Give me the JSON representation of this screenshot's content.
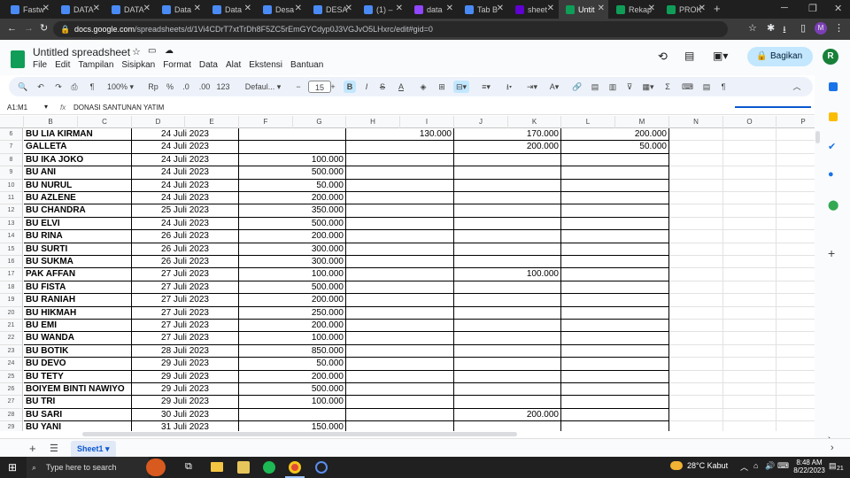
{
  "browser": {
    "tabs": [
      {
        "label": "Fastw",
        "icon": "docs-icon"
      },
      {
        "label": "DATA",
        "icon": "docs-icon"
      },
      {
        "label": "DATA",
        "icon": "docs-icon"
      },
      {
        "label": "Data",
        "icon": "docs-icon"
      },
      {
        "label": "Data",
        "icon": "docs-icon"
      },
      {
        "label": "Desa",
        "icon": "docs-icon"
      },
      {
        "label": "DESA",
        "icon": "docs-icon"
      },
      {
        "label": "(1) –",
        "icon": "docs-icon"
      },
      {
        "label": "data",
        "icon": "twitch-icon"
      },
      {
        "label": "Tab B",
        "icon": "globe-icon"
      },
      {
        "label": "sheet",
        "icon": "yahoo-icon"
      },
      {
        "label": "Untit",
        "icon": "sheets-icon",
        "active": true
      },
      {
        "label": "Rekap",
        "icon": "sheets-icon"
      },
      {
        "label": "PROK",
        "icon": "sheets-icon"
      }
    ],
    "new_tab": "+",
    "url_host": "docs.google.com",
    "url_path": "/spreadsheets/d/1Vi4CDrT7xtTrDh8F5ZC5rEmGYCdyp0J3VGJvO5LHxrc/edit#gid=0"
  },
  "app": {
    "title": "Untitled spreadsheet",
    "menus": [
      "File",
      "Edit",
      "Tampilan",
      "Sisipkan",
      "Format",
      "Data",
      "Alat",
      "Ekstensi",
      "Bantuan"
    ],
    "share_label": "Bagikan",
    "avatar_letter": "R"
  },
  "toolbar": {
    "zoom": "100%",
    "currency": "Rp",
    "percent": "%",
    "dec_less": ".0",
    "dec_more": ".00",
    "format_123": "123",
    "font": "Defaul...",
    "font_size": "15",
    "bold": "B",
    "italic": "I",
    "strike": "S",
    "text_color": "A"
  },
  "formula_bar": {
    "cell_ref": "A1:M1",
    "fx": "fx",
    "content": "DONASI SANTUNAN YATIM"
  },
  "columns": [
    "B",
    "C",
    "D",
    "E",
    "F",
    "G",
    "H",
    "I",
    "J",
    "K",
    "L",
    "M",
    "N",
    "O",
    "P"
  ],
  "rows": [
    {
      "n": "6",
      "name": "BU LIA KIRMAN",
      "date": "24 Juli 2023",
      "g": "",
      "i": "130.000",
      "k": "170.000",
      "m": "200.000"
    },
    {
      "n": "7",
      "name": "GALLETA",
      "date": "24 Juli 2023",
      "g": "",
      "i": "",
      "k": "200.000",
      "m": "50.000"
    },
    {
      "n": "8",
      "name": "BU IKA JOKO",
      "date": "24 Juli 2023",
      "g": "100.000",
      "i": "",
      "k": "",
      "m": ""
    },
    {
      "n": "9",
      "name": "BU ANI",
      "date": "24 Juli 2023",
      "g": "500.000",
      "i": "",
      "k": "",
      "m": ""
    },
    {
      "n": "10",
      "name": "BU NURUL",
      "date": "24 Juli 2023",
      "g": "50.000",
      "i": "",
      "k": "",
      "m": ""
    },
    {
      "n": "11",
      "name": "BU AZLENE",
      "date": "24 Juli 2023",
      "g": "200.000",
      "i": "",
      "k": "",
      "m": ""
    },
    {
      "n": "12",
      "name": "BU CHANDRA",
      "date": "25 Juli 2023",
      "g": "350.000",
      "i": "",
      "k": "",
      "m": ""
    },
    {
      "n": "13",
      "name": "BU ELVI",
      "date": "24 Juli 2023",
      "g": "500.000",
      "i": "",
      "k": "",
      "m": ""
    },
    {
      "n": "14",
      "name": "BU RINA",
      "date": "26 Juli 2023",
      "g": "200.000",
      "i": "",
      "k": "",
      "m": ""
    },
    {
      "n": "15",
      "name": "BU SURTI",
      "date": "26 Juli 2023",
      "g": "300.000",
      "i": "",
      "k": "",
      "m": ""
    },
    {
      "n": "16",
      "name": "BU SUKMA",
      "date": "26 Juli 2023",
      "g": "300.000",
      "i": "",
      "k": "",
      "m": ""
    },
    {
      "n": "17",
      "name": "PAK AFFAN",
      "date": "27 Juli 2023",
      "g": "100.000",
      "i": "",
      "k": "100.000",
      "m": ""
    },
    {
      "n": "18",
      "name": "BU FISTA",
      "date": "27 Juli 2023",
      "g": "500.000",
      "i": "",
      "k": "",
      "m": ""
    },
    {
      "n": "19",
      "name": "BU RANIAH",
      "date": "27 Juli 2023",
      "g": "200.000",
      "i": "",
      "k": "",
      "m": ""
    },
    {
      "n": "20",
      "name": "BU HIKMAH",
      "date": "27 Juli 2023",
      "g": "250.000",
      "i": "",
      "k": "",
      "m": ""
    },
    {
      "n": "21",
      "name": "BU EMI",
      "date": "27 Juli 2023",
      "g": "200.000",
      "i": "",
      "k": "",
      "m": ""
    },
    {
      "n": "22",
      "name": "BU WANDA",
      "date": "27 Juli 2023",
      "g": "100.000",
      "i": "",
      "k": "",
      "m": ""
    },
    {
      "n": "23",
      "name": "BU BOTIK",
      "date": "28 Juli 2023",
      "g": "850.000",
      "i": "",
      "k": "",
      "m": ""
    },
    {
      "n": "24",
      "name": "BU DEVO",
      "date": "29 Juli 2023",
      "g": "50.000",
      "i": "",
      "k": "",
      "m": ""
    },
    {
      "n": "25",
      "name": "BU TETY",
      "date": "29 Juli 2023",
      "g": "200.000",
      "i": "",
      "k": "",
      "m": ""
    },
    {
      "n": "26",
      "name": "BOIYEM BINTI NAWIYO",
      "date": "29 Juli 2023",
      "g": "500.000",
      "i": "",
      "k": "",
      "m": ""
    },
    {
      "n": "27",
      "name": "BU TRI",
      "date": "29 Juli 2023",
      "g": "100.000",
      "i": "",
      "k": "",
      "m": ""
    },
    {
      "n": "28",
      "name": "BU SARI",
      "date": "30 Juli 2023",
      "g": "",
      "i": "",
      "k": "200.000",
      "m": ""
    },
    {
      "n": "29",
      "name": "BU YANI",
      "date": "31 Juli 2023",
      "g": "150.000",
      "i": "",
      "k": "",
      "m": ""
    }
  ],
  "sheet_tab": "Sheet1",
  "taskbar": {
    "search_placeholder": "Type here to search",
    "weather": "28°C  Kabut",
    "time": "8:48 AM",
    "date": "8/22/2023",
    "notif_count": "21"
  },
  "colors": {
    "sheets_green": "#0f9d58",
    "share_bg": "#c2e7ff",
    "accent_blue": "#0b57d0"
  }
}
